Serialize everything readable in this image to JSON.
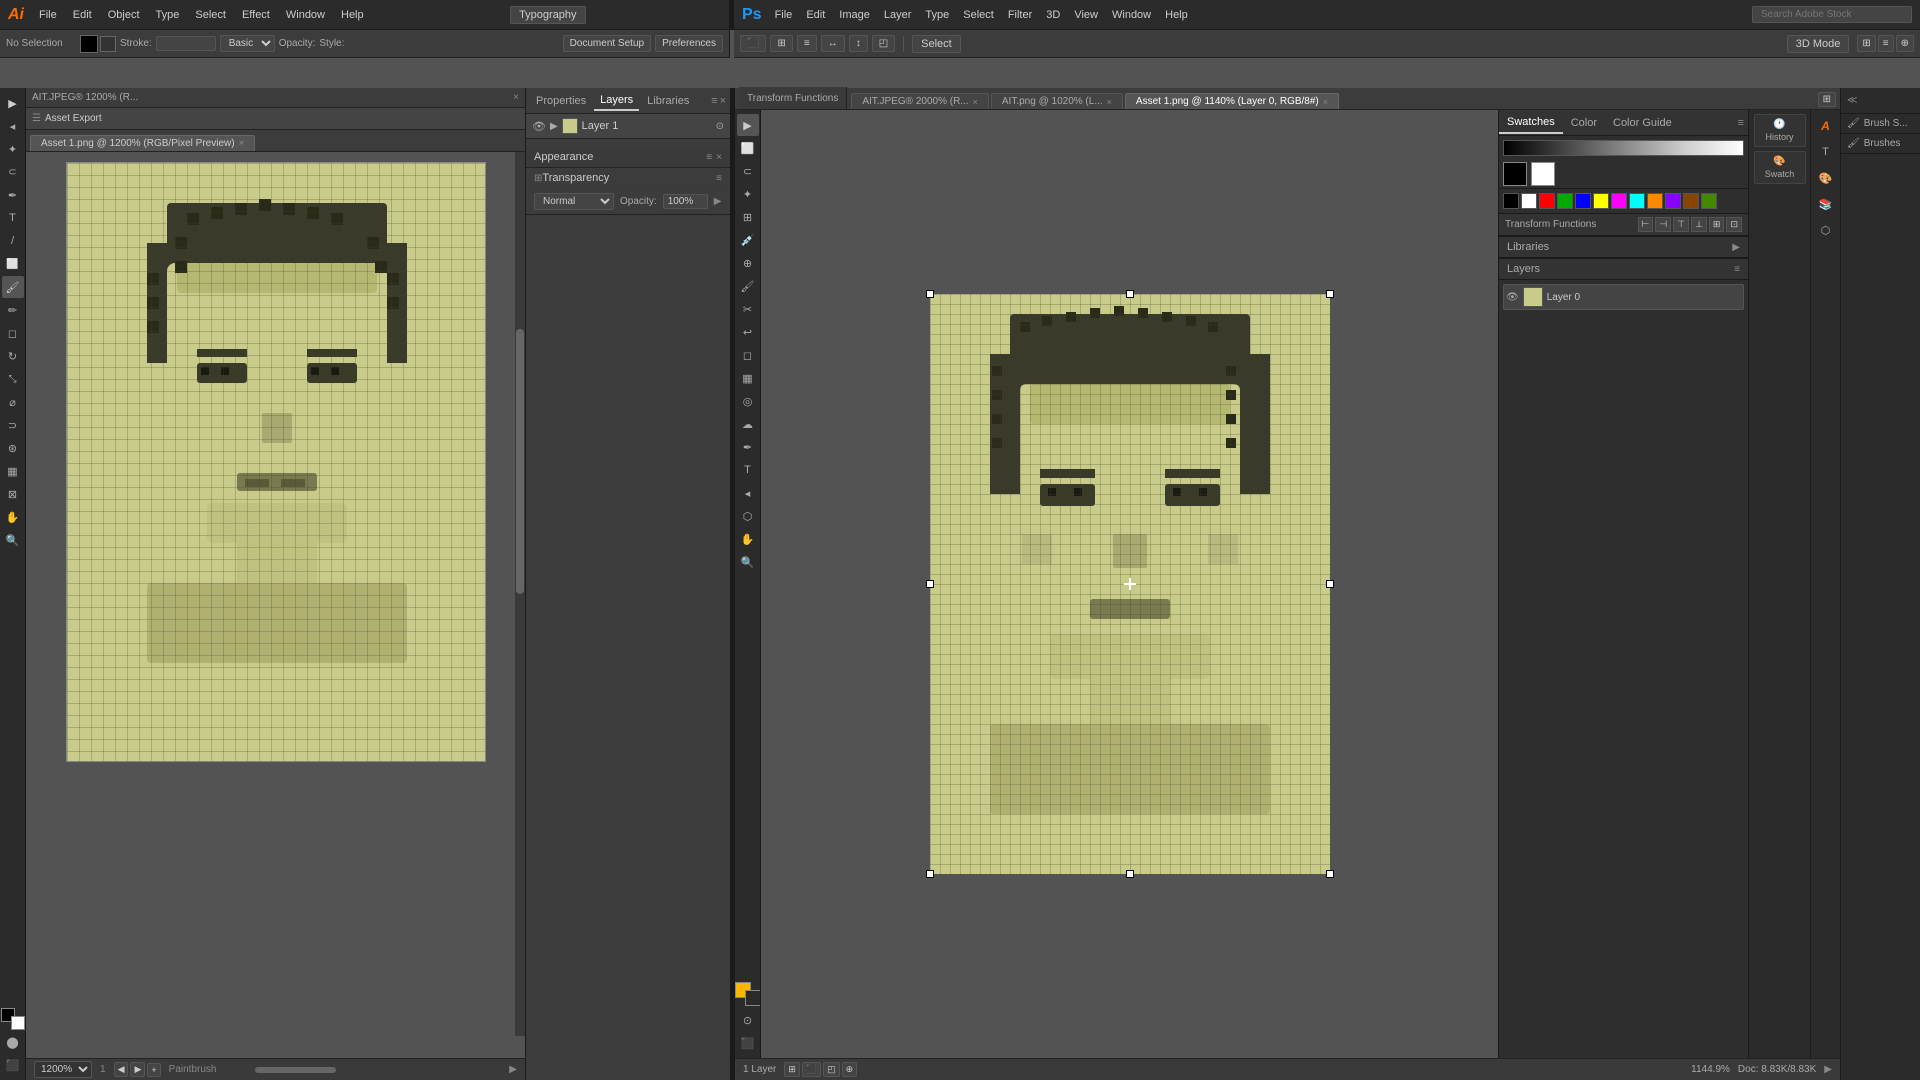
{
  "app": {
    "ai_logo": "Ai",
    "ps_logo": "Ps"
  },
  "ai_menubar": {
    "menus": [
      "File",
      "Edit",
      "Object",
      "Type",
      "Select",
      "Effect",
      "Window",
      "Help"
    ],
    "typography_label": "Typography",
    "search_placeholder": "Search Adobe Stock",
    "no_selection": "No Selection",
    "stroke_label": "Stroke:",
    "basic_label": "Basic",
    "opacity_label": "Opacity:",
    "style_label": "Style:",
    "document_setup": "Document Setup",
    "preferences": "Preferences"
  },
  "ai_panel": {
    "title": "AIT.JPEG® 1200% (R...",
    "export_label": "Asset Export",
    "canvas_title1": "Asset 1.png @ 1200% (RGB/Pixel Preview)",
    "zoom_level": "1200%",
    "page_num": "1",
    "status_text": "Paintbrush"
  },
  "mid_panel": {
    "tabs": [
      "Properties",
      "Layers",
      "Libraries"
    ],
    "layer_name": "Layer 1",
    "appearance_title": "Appearance",
    "transparency_label": "Transparency",
    "blending_mode": "Normal",
    "opacity_value": "100%",
    "opacity_label": "Opacity:"
  },
  "ps_menubar": {
    "menus": [
      "File",
      "Edit",
      "Image",
      "Layer",
      "Type",
      "Select",
      "Filter",
      "3D",
      "View",
      "Window",
      "Help"
    ],
    "select_label": "Select"
  },
  "ps_panel": {
    "canvas_tabs": [
      {
        "label": "AIT.JPEG® 2000% (R...",
        "closeable": true
      },
      {
        "label": "AIT.png @ 1020% (L...",
        "closeable": true
      },
      {
        "label": "Asset 1.png @ 1140% (Layer 0, RGB/8#)",
        "closeable": true,
        "active": true
      }
    ],
    "zoom_level": "1144.9%",
    "doc_size": "Doc: 8.83K/8.83K",
    "layer_label": "1 Layer",
    "mode_3d": "3D Mode"
  },
  "right_panel": {
    "swatches_label": "Swatches",
    "color_label": "Color",
    "color_guide_label": "Color Guide",
    "transform_label": "Transform Functions",
    "history_label": "History",
    "swatch_label": "Swatch",
    "libraries_label": "Libraries",
    "layers_label": "Layers"
  },
  "far_right": {
    "brush_s_label": "Brush S...",
    "brushes_label": "Brushes"
  },
  "ps_right_side": {
    "history_label": "History",
    "swatch_label": "Swatch"
  },
  "tools": {
    "ai_tools": [
      "▶",
      "✋",
      "✏",
      "T",
      "◎",
      "⬡",
      "🖊",
      "✂",
      "◰",
      "⊞",
      "↕",
      "⬤",
      "↔",
      "⌖",
      "⬛",
      "≡",
      "✦",
      "🔍",
      "✐",
      "▪"
    ],
    "ps_tools": [
      "▶",
      "✋",
      "✏",
      "☁",
      "T",
      "⬡",
      "◎",
      "✂",
      "⬛",
      "↕",
      "🔍",
      "⌖",
      "✦",
      "≡",
      "⊞",
      "↔",
      "≈",
      "✐",
      "▪",
      "◈"
    ],
    "color_fg": "#000000",
    "color_bg": "#ffffff"
  },
  "swatches": {
    "colors": [
      "#000000",
      "#ffffff",
      "#ff0000",
      "#00ff00",
      "#0000ff",
      "#ffff00",
      "#ff00ff",
      "#00ffff",
      "#ff8800",
      "#8800ff",
      "#884400",
      "#448800",
      "#004488",
      "#880044",
      "#448844",
      "#888888"
    ]
  }
}
